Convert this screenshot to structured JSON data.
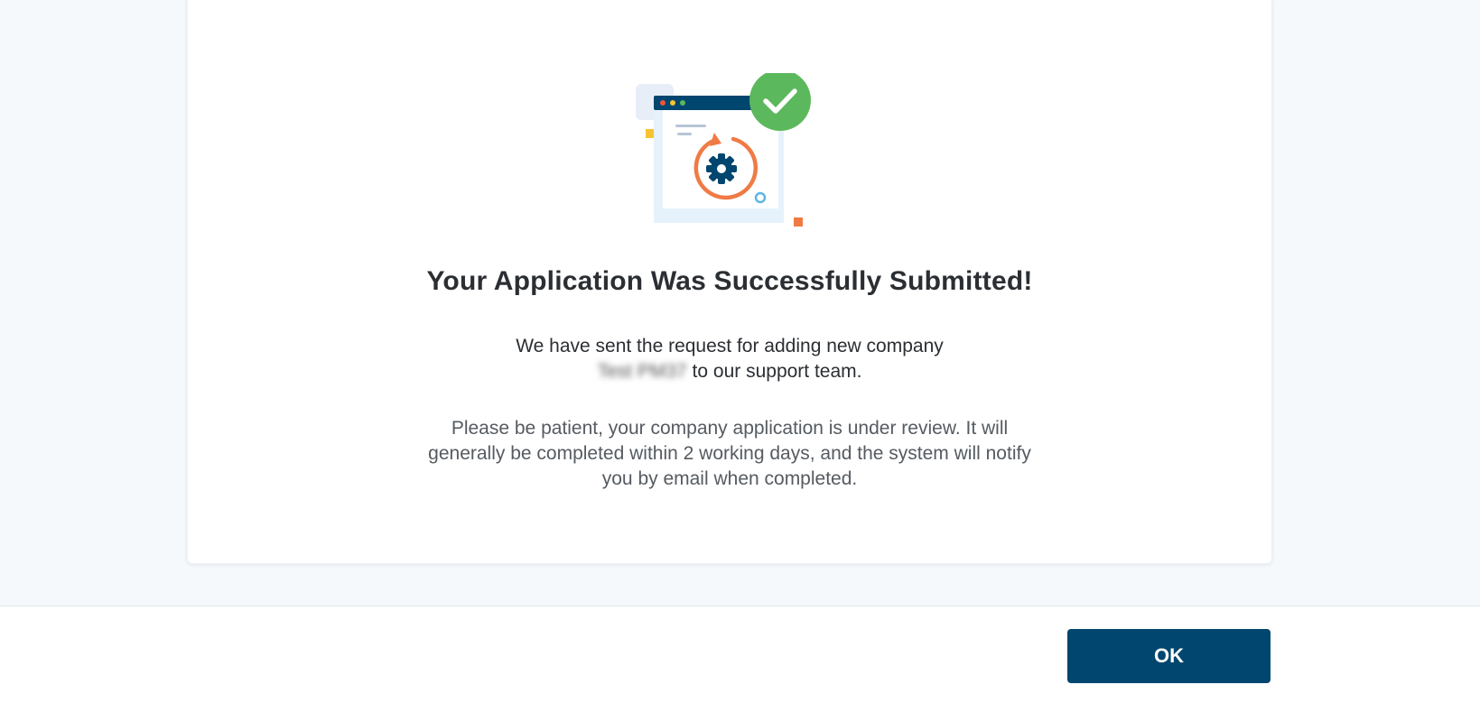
{
  "dialog": {
    "title": "Your Application Was Successfully Submitted!",
    "message_line1": "We have sent the request for adding new company",
    "company_name": "Test PM37",
    "message_line2_suffix": " to our support team.",
    "note": "Please be patient, your company application is under review. It will generally be completed within 2 working days, and the system will notify you by email when completed."
  },
  "illustration": {
    "icon": "application-submitted-illustration",
    "check_icon": "check-circle-icon",
    "colors": {
      "check": "#5cb85c",
      "window_bar": "#00466e",
      "refresh_ring": "#f07a45",
      "gear": "#00466e",
      "panel": "#e6f2fb"
    }
  },
  "footer": {
    "ok_label": "OK"
  },
  "colors": {
    "primary": "#00466e",
    "background": "#f5f9fc"
  }
}
